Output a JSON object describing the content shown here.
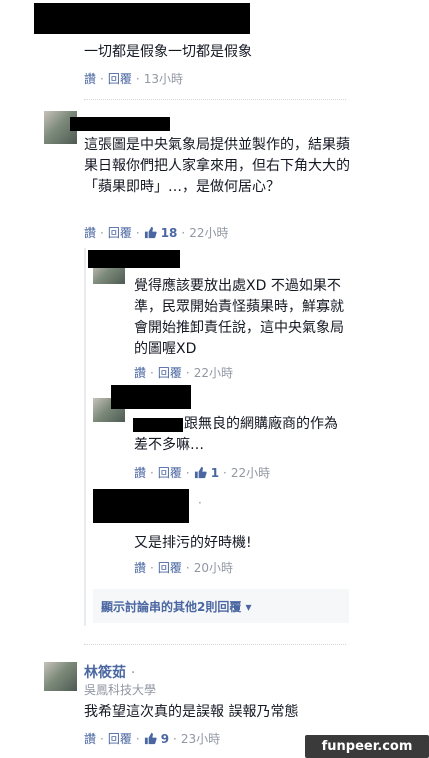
{
  "actions": {
    "read": "讚",
    "reply": "回覆",
    "dot": "·"
  },
  "comments": [
    {
      "text": "一切都是假象一切都是假象",
      "likes": "",
      "time": "13小時"
    },
    {
      "text": "這張圖是中央氣象局提供並製作的，結果蘋果日報你們把人家拿來用，但右下角大大的「蘋果即時」…，是做何居心？",
      "likes": "18",
      "time": "22小時"
    }
  ],
  "replies": [
    {
      "text": "覺得應該要放出處XD 不過如果不準，民眾開始責怪蘋果時，鮮寡就會開始推卸責任說，這中央氣象局的圖喔XD",
      "likes": "",
      "time": "22小時"
    },
    {
      "text": "跟無良的網購廠商的作為差不多嘛…",
      "likes": "1",
      "time": "22小時"
    },
    {
      "text": "又是排污的好時機!",
      "likes": "",
      "time": "20小時"
    }
  ],
  "more_replies_label": "顯示討論串的其他2則回覆 ▾",
  "last_comment": {
    "name": "林筱茹",
    "name_dot": "·",
    "school": "吳鳳科技大學",
    "text": "我希望這次真的是誤報 誤報乃常態",
    "likes": "9",
    "time": "23小時"
  },
  "watermark": "funpeer.com",
  "colors": {
    "link": "#4b67a1",
    "meta": "#9197a3",
    "text": "#141823"
  }
}
